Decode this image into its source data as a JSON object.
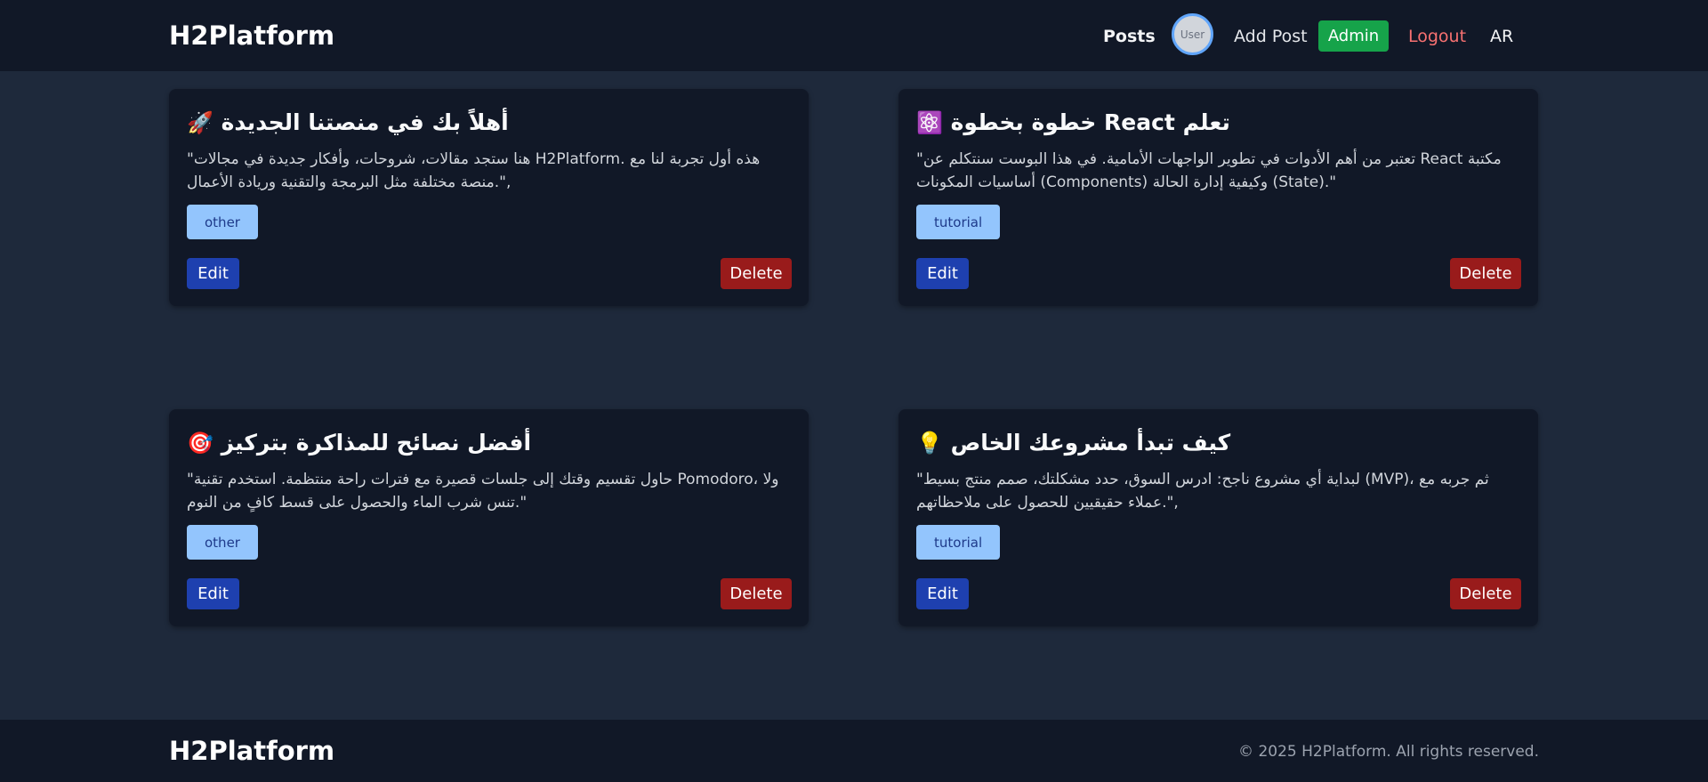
{
  "header": {
    "brand": "H2Platform",
    "nav": {
      "posts": "Posts",
      "avatar_alt": "User",
      "add_post": "Add Post",
      "admin": "Admin",
      "logout": "Logout",
      "lang": "AR"
    }
  },
  "posts": [
    {
      "emoji": "🚀",
      "title": "أهلاً بك في منصتنا الجديدة",
      "body": "\"هنا ستجد مقالات، شروحات، وأفكار جديدة في مجالات H2Platform. هذه أول تجربة لنا مع منصة مختلفة مثل البرمجة والتقنية وريادة الأعمال.\",",
      "tag": "other",
      "edit": "Edit",
      "delete": "Delete"
    },
    {
      "emoji": "⚛️",
      "title": "خطوة بخطوة React تعلم",
      "body": "\"تعتبر من أهم الأدوات في تطوير الواجهات الأمامية. في هذا البوست سنتكلم عن React مكتبة أساسيات المكونات (Components) وكيفية إدارة الحالة (State).\"",
      "tag": "tutorial",
      "edit": "Edit",
      "delete": "Delete"
    },
    {
      "emoji": "🎯",
      "title": "أفضل نصائح للمذاكرة بتركيز",
      "body": "\"حاول تقسيم وقتك إلى جلسات قصيرة مع فترات راحة منتظمة. استخدم تقنية Pomodoro، ولا تنس شرب الماء والحصول على قسط كافٍ من النوم.\"",
      "tag": "other",
      "edit": "Edit",
      "delete": "Delete"
    },
    {
      "emoji": "💡",
      "title": "كيف تبدأ مشروعك الخاص",
      "body": "\"لبداية أي مشروع ناجح: ادرس السوق، حدد مشكلتك، صمم منتج بسيط (MVP)، ثم جربه مع عملاء حقيقيين للحصول على ملاحظاتهم.\",",
      "tag": "tutorial",
      "edit": "Edit",
      "delete": "Delete"
    }
  ],
  "footer": {
    "brand": "H2Platform",
    "copyright": "© 2025 H2Platform. All rights reserved."
  },
  "colors": {
    "page_bg": "#1e293b",
    "bar_bg": "#111827",
    "card_bg": "#111827",
    "admin_bg": "#16a34a",
    "logout_text": "#f87171",
    "tag_bg": "#93c5fd",
    "edit_bg": "#1e40af",
    "delete_bg": "#991b1b"
  }
}
